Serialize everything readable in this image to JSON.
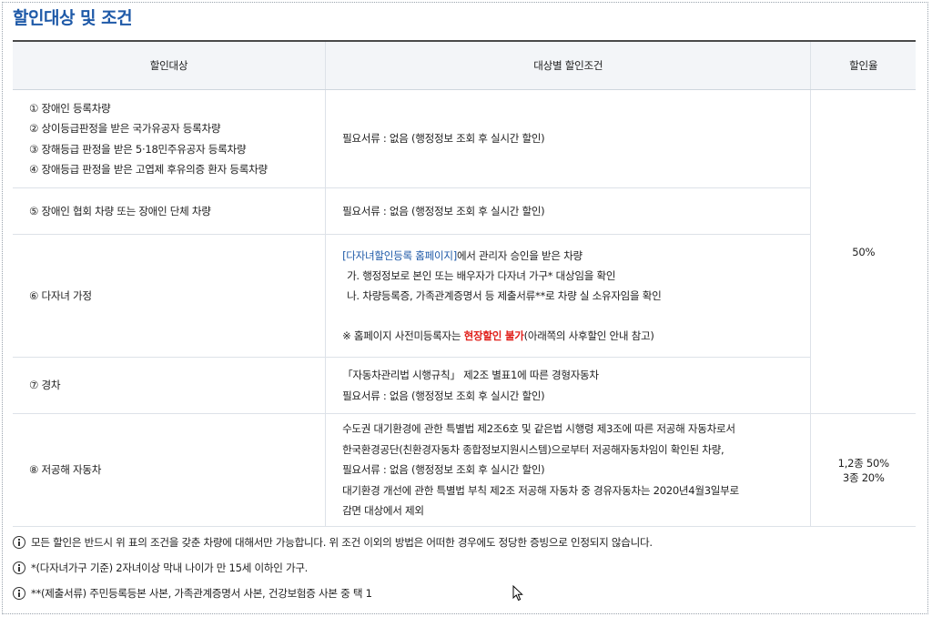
{
  "page_title": "할인대상 및 조건",
  "table": {
    "headers": [
      "할인대상",
      "대상별 할인조건",
      "할인율"
    ],
    "rows": [
      {
        "target": [
          "① 장애인 등록차량",
          "② 상이등급판정을 받은 국가유공자 등록차량",
          "③ 장해등급 판정을 받은 5·18민주유공자 등록차량",
          "④ 장애등급 판정을 받은 고엽제 후유의증 환자 등록차량"
        ],
        "condition": [
          "필요서류 : 없음 (행정정보 조회 후 실시간 할인)"
        ]
      },
      {
        "target": [
          "⑤ 장애인 협회 차량 또는 장애인 단체 차량"
        ],
        "condition": [
          "필요서류 : 없음 (행정정보 조회 후 실시간 할인)"
        ]
      },
      {
        "target": [
          "⑥ 다자녀 가정"
        ],
        "condition_link": "[다자녀할인등록 홈페이지]",
        "condition_link_suffix": "에서 관리자 승인을 받은 차량",
        "condition_sub": [
          "가. 행정정보로 본인 또는 배우자가 다자녀 가구* 대상임을 확인",
          "나. 차량등록증, 가족관계증명서 등 제출서류**로 차량 실 소유자임을 확인"
        ],
        "notice_prefix": "※ 홈페이지 사전미등록자는 ",
        "notice_highlight": "현장할인 불가",
        "notice_suffix": "(아래쪽의 사후할인 안내 참고)"
      },
      {
        "target": [
          "⑦ 경차"
        ],
        "condition": [
          "「자동차관리법 시행규칙」 제2조 별표1에 따른 경형자동차",
          "필요서류 : 없음 (행정정보 조회 후 실시간 할인)"
        ]
      },
      {
        "target": [
          "⑧ 저공해 자동차"
        ],
        "condition": [
          "수도권 대기환경에 관한 특별법 제2조6호 및 같은법 시행령 제3조에 따른 저공해 자동차로서",
          "한국환경공단(친환경자동차 종합정보지원시스템)으로부터 저공해자동차임이 확인된 차량,",
          "필요서류 : 없음 (행정정보 조회 후 실시간 할인)",
          "대기환경 개선에 관한 특별법 부칙 제2조 저공해 자동차 중 경유자동차는 2020년4월3일부로",
          "감면 대상에서 제외"
        ],
        "rate": [
          "1,2종 50%",
          "3종 20%"
        ]
      }
    ],
    "shared_rate": "50%"
  },
  "notes": [
    "모든 할인은 반드시 위 표의 조건을 갖춘 차량에 대해서만 가능합니다. 위 조건 이외의 방법은 어떠한 경우에도 정당한 증빙으로 인정되지 않습니다.",
    "*(다자녀가구 기준) 2자녀이상 막내 나이가 만 15세 이하인 가구.",
    "**(제출서류) 주민등록등본 사본, 가족관계증명서 사본, 건강보험증 사본 중 택 1"
  ],
  "icons": {
    "note_icon": "info-circle-icon",
    "cursor": "mouse-pointer-icon"
  },
  "colors": {
    "title": "#1f5aa8",
    "link": "#1f5aa8",
    "highlight": "#e0201b",
    "header_bg": "#f3f5f8"
  }
}
